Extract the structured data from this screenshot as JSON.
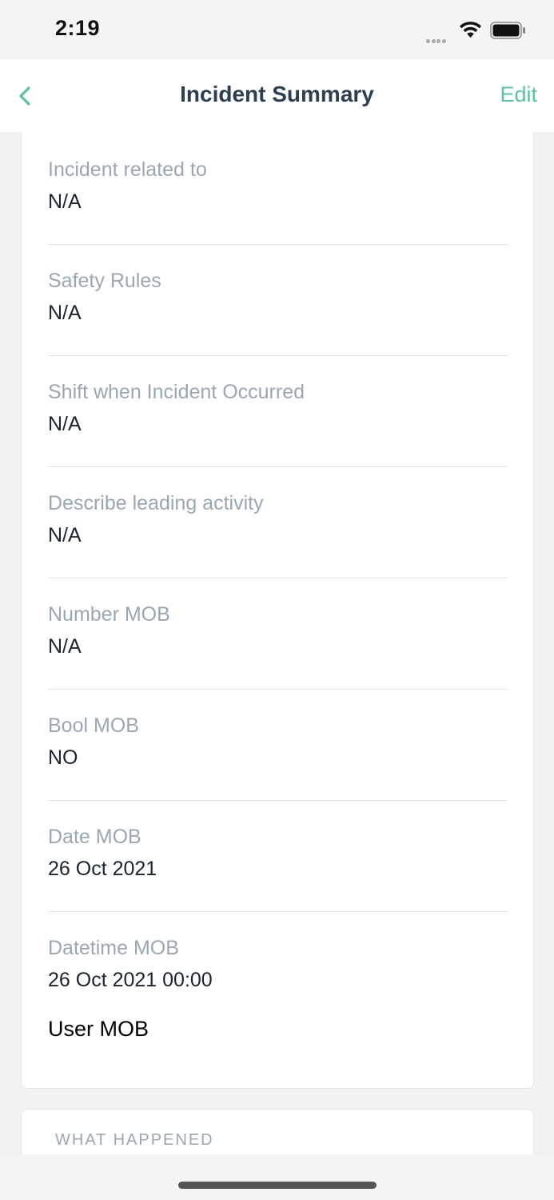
{
  "status_bar": {
    "time": "2:19"
  },
  "nav": {
    "title": "Incident Summary",
    "edit_label": "Edit",
    "back_icon": "chevron-left-icon",
    "accent_color": "#59c49b"
  },
  "fields": [
    {
      "label": "Incident related to",
      "value": "N/A"
    },
    {
      "label": "Safety Rules",
      "value": "N/A"
    },
    {
      "label": "Shift when Incident Occurred",
      "value": "N/A"
    },
    {
      "label": "Describe leading activity",
      "value": "N/A"
    },
    {
      "label": "Number MOB",
      "value": "N/A"
    },
    {
      "label": "Bool MOB",
      "value": "NO"
    },
    {
      "label": "Date MOB",
      "value": "26 Oct 2021"
    },
    {
      "label": "Datetime MOB",
      "value": "26 Oct 2021 00:00"
    }
  ],
  "user_field": {
    "label": "User MOB"
  },
  "next_section": {
    "title": "WHAT HAPPENED"
  }
}
